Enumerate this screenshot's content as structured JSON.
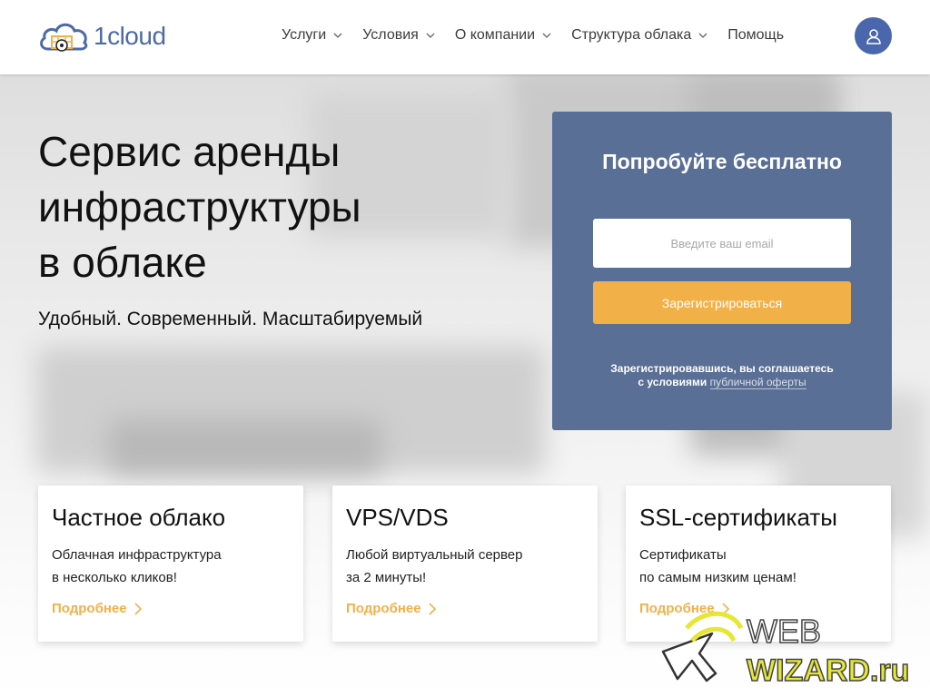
{
  "header": {
    "logo_text": "1cloud",
    "nav": [
      {
        "label": "Услуги",
        "has_dropdown": true
      },
      {
        "label": "Условия",
        "has_dropdown": true
      },
      {
        "label": "О компании",
        "has_dropdown": true
      },
      {
        "label": "Структура облака",
        "has_dropdown": true
      },
      {
        "label": "Помощь",
        "has_dropdown": false
      }
    ],
    "user_icon": "user-icon"
  },
  "hero": {
    "title_line1": "Сервис аренды",
    "title_line2": "инфраструктуры",
    "title_line3": "в облаке",
    "subtitle": "Удобный. Современный. Масштабируемый"
  },
  "signup": {
    "title": "Попробуйте бесплатно",
    "email_placeholder": "Введите ваш email",
    "button_label": "Зарегистрироваться",
    "note_line1": "Зарегистрировавшись, вы соглашаетесь",
    "note_prefix": "с условиями",
    "note_link": "публичной оферты"
  },
  "cards": [
    {
      "title": "Частное облако",
      "desc_line1": "Облачная инфраструктура",
      "desc_line2": "в несколько кликов!",
      "more": "Подробнее"
    },
    {
      "title": "VPS/VDS",
      "desc_line1": "Любой виртуальный сервер",
      "desc_line2": "за 2 минуты!",
      "more": "Подробнее"
    },
    {
      "title": "SSL-сертификаты",
      "desc_line1": "Сертификаты",
      "desc_line2": "по самым низким ценам!",
      "more": "Подробнее"
    }
  ],
  "watermark": {
    "line1": "WEB",
    "line2": "WIZARD.ru"
  },
  "colors": {
    "brand_blue": "#4d6aa6",
    "panel": "#5a6f95",
    "accent_orange": "#f2b048"
  }
}
